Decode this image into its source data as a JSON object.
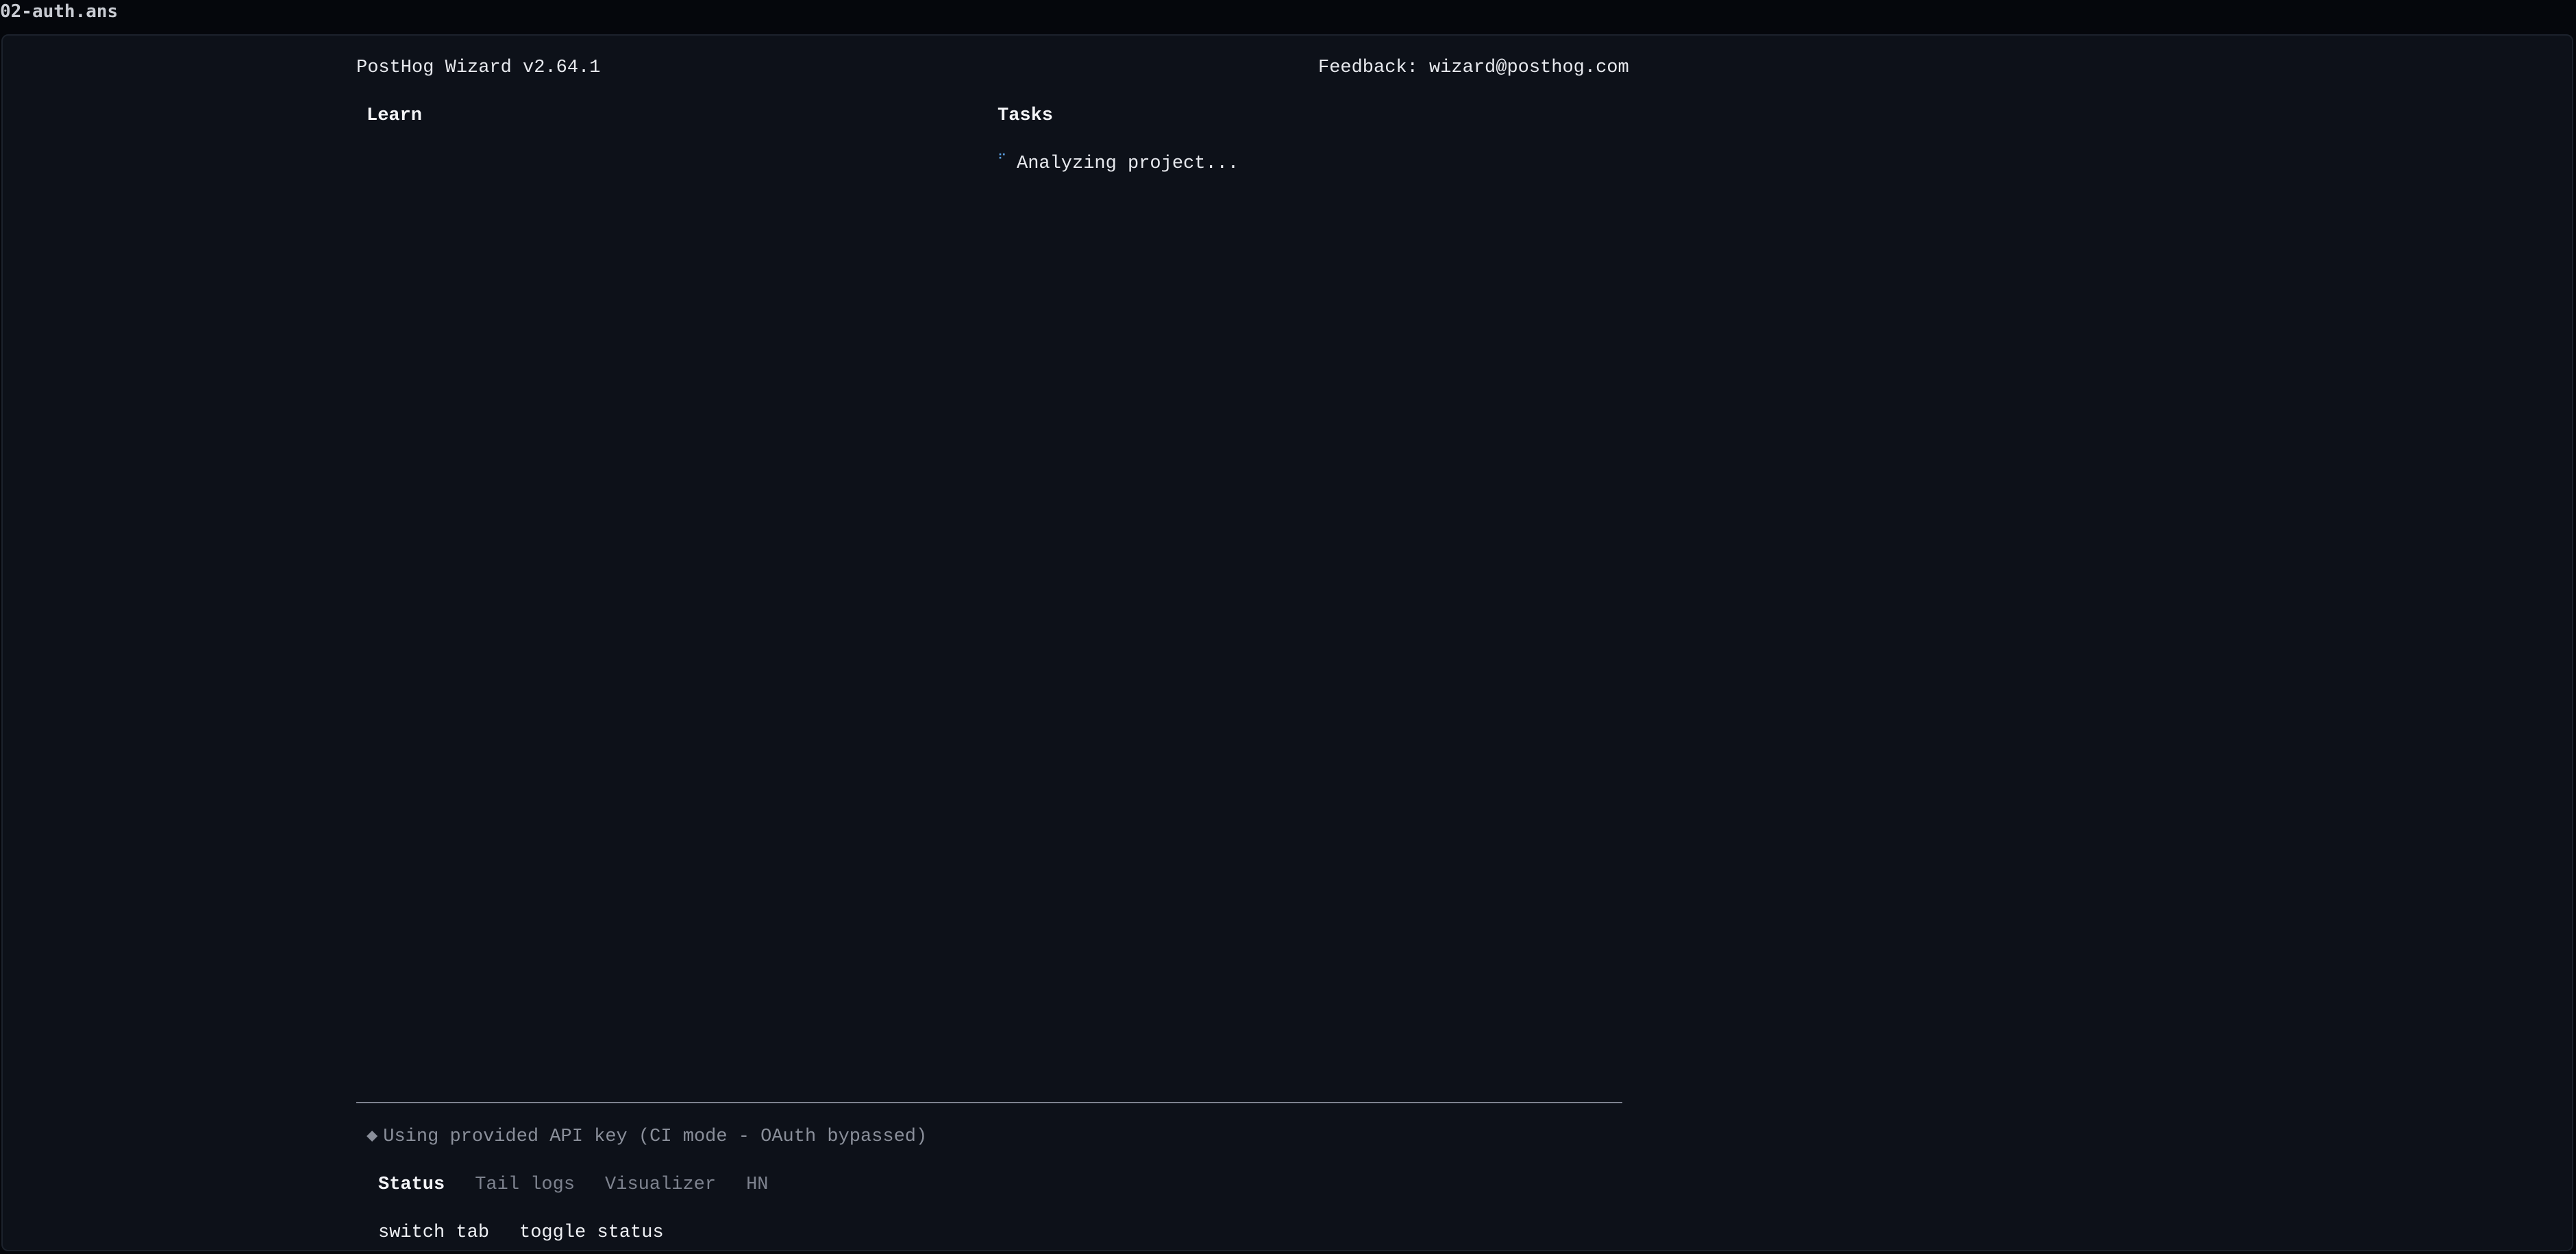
{
  "window": {
    "file_title": "02-auth.ans"
  },
  "header": {
    "app_version": "PostHog Wizard v2.64.1",
    "feedback": "Feedback: wizard@posthog.com"
  },
  "columns": {
    "learn_title": "Learn",
    "tasks_title": "Tasks"
  },
  "tasks": {
    "spinner_glyph": "⠋",
    "items": [
      {
        "label": "Analyzing project..."
      }
    ]
  },
  "status": {
    "bullet": "◆",
    "message": "Using provided API key (CI mode - OAuth bypassed)"
  },
  "tabs": [
    {
      "label": "Status",
      "active": true
    },
    {
      "label": "Tail logs",
      "active": false
    },
    {
      "label": "Visualizer",
      "active": false
    },
    {
      "label": "HN",
      "active": false
    }
  ],
  "hints": [
    {
      "label": "switch tab"
    },
    {
      "label": "toggle status"
    }
  ],
  "colors": {
    "background": "#0d1119",
    "spinner": "#5a9fe0",
    "muted_text": "#8a8f9a"
  }
}
